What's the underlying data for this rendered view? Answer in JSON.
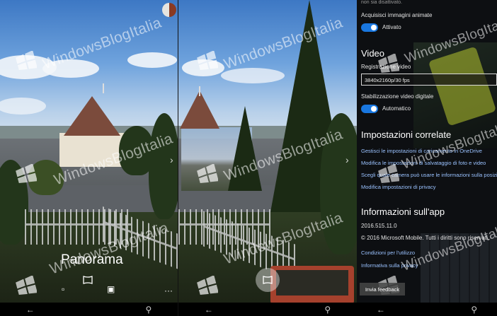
{
  "watermark_text": "WindowsBlogItalia",
  "camera": {
    "mode_label": "Panorama"
  },
  "settings": {
    "top_cut_text": "non sia disattivato.",
    "animated_label": "Acquisisci immagini animate",
    "animated_state": "Attivato",
    "video_heading": "Video",
    "video_rec_label": "Registrazione video",
    "video_rec_value": "3840x2160p/30 fps",
    "stabilization_label": "Stabilizzazione video digitale",
    "stabilization_state": "Automatico",
    "related_heading": "Impostazioni correlate",
    "related_links": [
      "Gestisci le impostazioni di caricamento in OneDrive",
      "Modifica le impostazioni di salvataggio di foto e video",
      "Scegli quale camera può usare le informazioni sulla posizione",
      "Modifica impostazioni di privacy"
    ],
    "about_heading": "Informazioni sull'app",
    "version": "2016.515.11.0",
    "copyright": "© 2016 Microsoft Mobile. Tutti i diritti sono riservati.",
    "terms_link": "Condizioni per l'utilizzo",
    "privacy_link": "Informativa sulla privacy",
    "feedback_button": "Invia feedback"
  },
  "colors": {
    "accent": "#1977e0",
    "link": "#9ac2ff"
  },
  "icons": [
    "back-arrow-icon",
    "windows-start-icon",
    "search-icon",
    "panorama-icon",
    "video-icon",
    "photo-icon",
    "more-icon"
  ]
}
